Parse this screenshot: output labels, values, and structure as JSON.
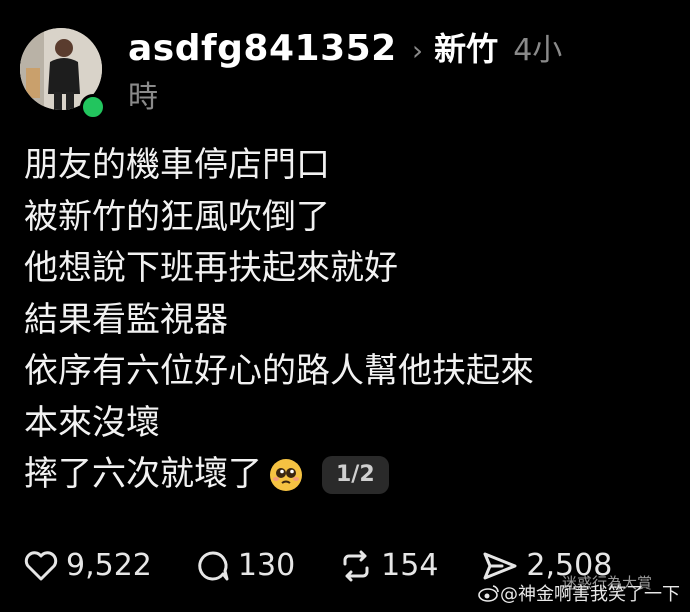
{
  "post": {
    "username": "asdfg841352",
    "location": "新竹",
    "time_part1": "4小",
    "time_part2": "時",
    "lines": [
      "朋友的機車停店門口",
      "被新竹的狂風吹倒了",
      "他想說下班再扶起來就好",
      "結果看監視器",
      "依序有六位好心的路人幫他扶起來",
      "本來沒壞",
      "摔了六次就壞了"
    ],
    "page_indicator": "1/2"
  },
  "actions": {
    "likes": "9,522",
    "comments": "130",
    "reposts": "154",
    "shares": "2,508"
  },
  "watermark": {
    "text": "@神金啊害我笑了一下",
    "partial_text": "迷惑行為大賞"
  },
  "colors": {
    "background": "#000000",
    "text": "#f2f2f2",
    "muted": "#8a8a8a",
    "online": "#22c55e"
  }
}
